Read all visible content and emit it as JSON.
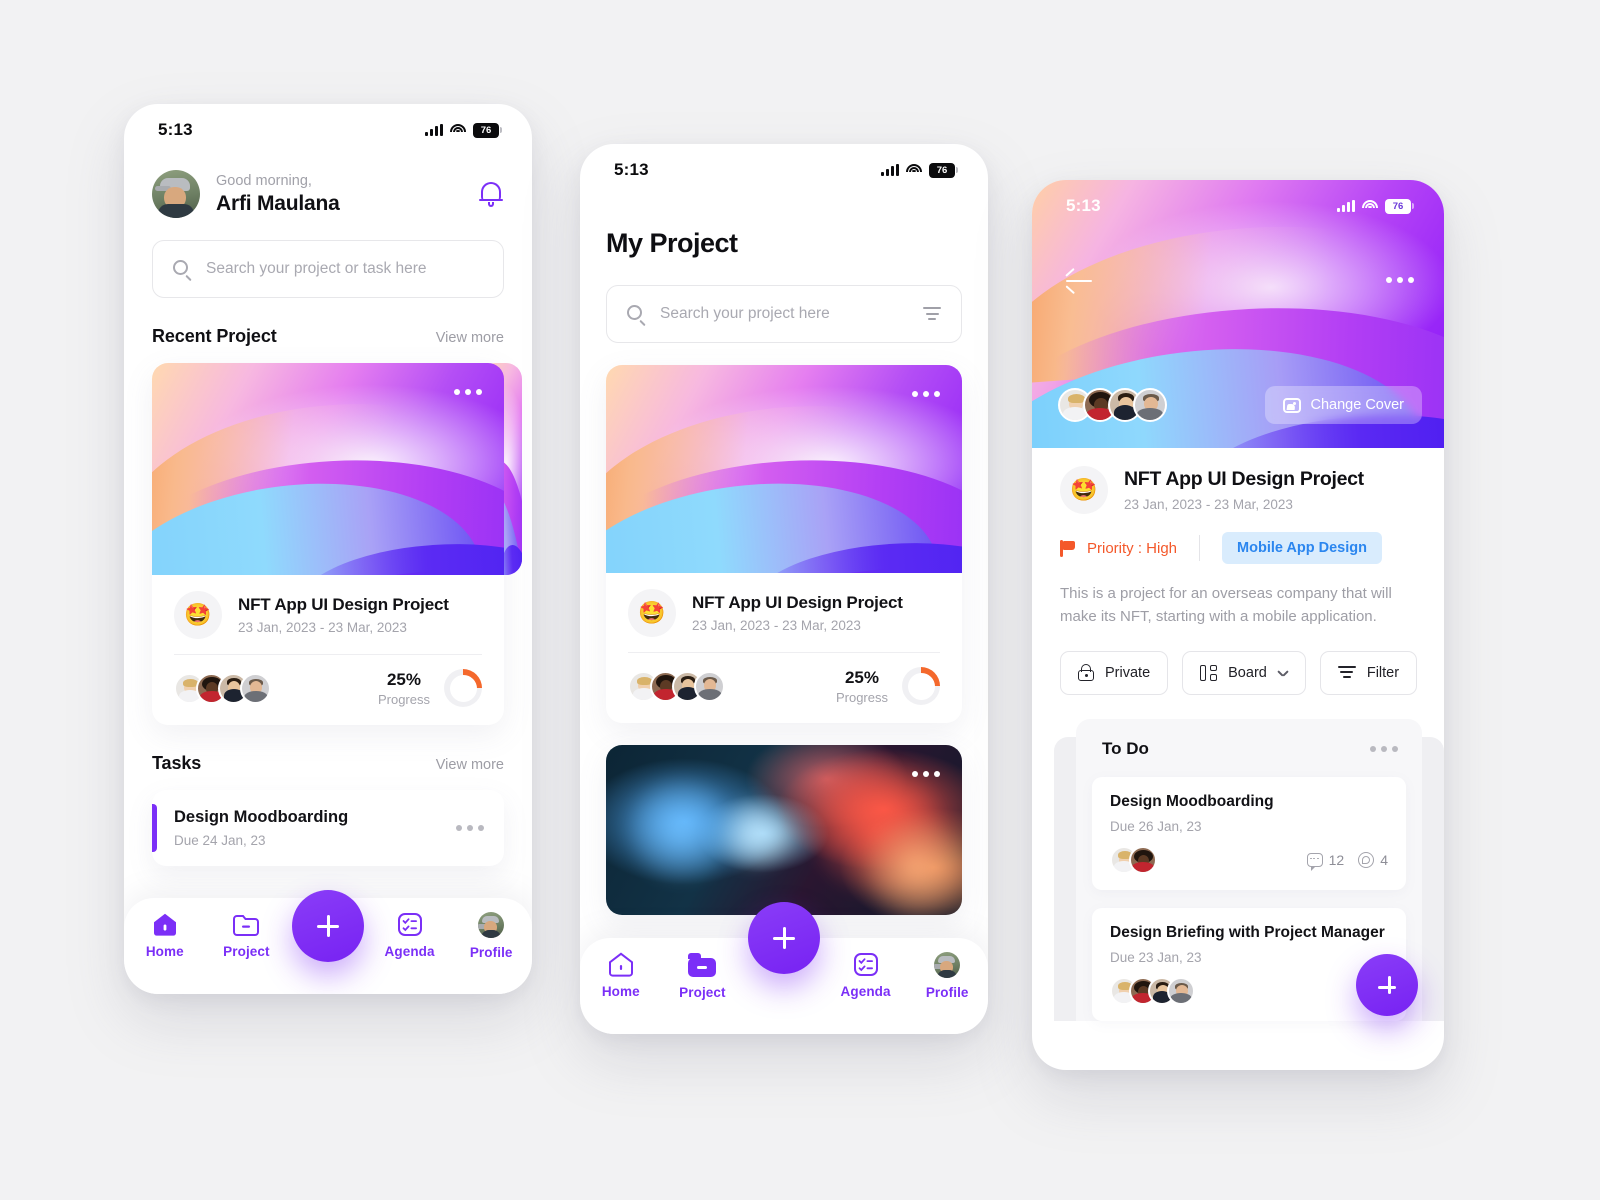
{
  "status_bar": {
    "time": "5:13",
    "battery": "76"
  },
  "phone1": {
    "greeting": "Good morning,",
    "user_name": "Arfi Maulana",
    "notification_icon": "bell-icon",
    "search": {
      "placeholder": "Search your project or task here"
    },
    "recent_section": {
      "title": "Recent Project",
      "view_more": "View more"
    },
    "project_card": {
      "emoji": "🤩",
      "title": "NFT App UI Design Project",
      "date_range": "23 Jan, 2023 - 23 Mar, 2023",
      "progress_value": "25%",
      "progress_label": "Progress",
      "progress_percent": 25
    },
    "tasks_section": {
      "title": "Tasks",
      "view_more": "View more"
    },
    "task_card": {
      "title": "Design Moodboarding",
      "due": "Due 24 Jan, 23"
    },
    "nav": [
      {
        "label": "Home",
        "icon": "home-icon",
        "active": true
      },
      {
        "label": "Project",
        "icon": "folder-icon",
        "active": false
      },
      {
        "label": "Agenda",
        "icon": "checklist-icon",
        "active": false
      },
      {
        "label": "Profile",
        "icon": "avatar-icon",
        "active": false
      }
    ],
    "fab_label": "+"
  },
  "phone2": {
    "page_title": "My Project",
    "search": {
      "placeholder": "Search your project here"
    },
    "filter_icon": "filter-icon",
    "project_card": {
      "emoji": "🤩",
      "title": "NFT App UI Design Project",
      "date_range": "23 Jan, 2023 - 23 Mar, 2023",
      "progress_value": "25%",
      "progress_label": "Progress",
      "progress_percent": 25
    },
    "nav": [
      {
        "label": "Home",
        "icon": "home-icon",
        "active": false
      },
      {
        "label": "Project",
        "icon": "folder-icon",
        "active": true
      },
      {
        "label": "Agenda",
        "icon": "checklist-icon",
        "active": false
      },
      {
        "label": "Profile",
        "icon": "avatar-icon",
        "active": false
      }
    ],
    "fab_label": "+"
  },
  "phone3": {
    "back_icon": "back-arrow-icon",
    "more_icon": "more-options-icon",
    "change_cover": {
      "label": "Change Cover",
      "icon": "image-icon"
    },
    "project": {
      "emoji": "🤩",
      "title": "NFT App UI Design Project",
      "date_range": "23 Jan, 2023 - 23 Mar, 2023",
      "priority": "Priority : High",
      "tag": "Mobile App Design",
      "description": "This is a project for an overseas company that will make its NFT, starting with a mobile application."
    },
    "buttons": [
      {
        "label": "Private",
        "icon": "lock-icon"
      },
      {
        "label": "Board",
        "icon": "board-icon",
        "chevron": "chevron-down-icon"
      },
      {
        "label": "Filter",
        "icon": "filter-icon"
      }
    ],
    "todo": {
      "title": "To Do",
      "cards": [
        {
          "title": "Design Moodboarding",
          "due": "Due 26 Jan, 23",
          "comments": "12",
          "attachments": "4"
        },
        {
          "title": "Design Briefing with Project Manager",
          "due": "Due 23 Jan, 23"
        }
      ]
    },
    "fab_label": "+"
  },
  "colors": {
    "accent": "#7b2ff7",
    "progress": "#f4682c",
    "priority": "#f4582a",
    "tag_text": "#2b86ef",
    "tag_bg": "#d9ecfd",
    "page_bg": "#f2f2f3"
  }
}
